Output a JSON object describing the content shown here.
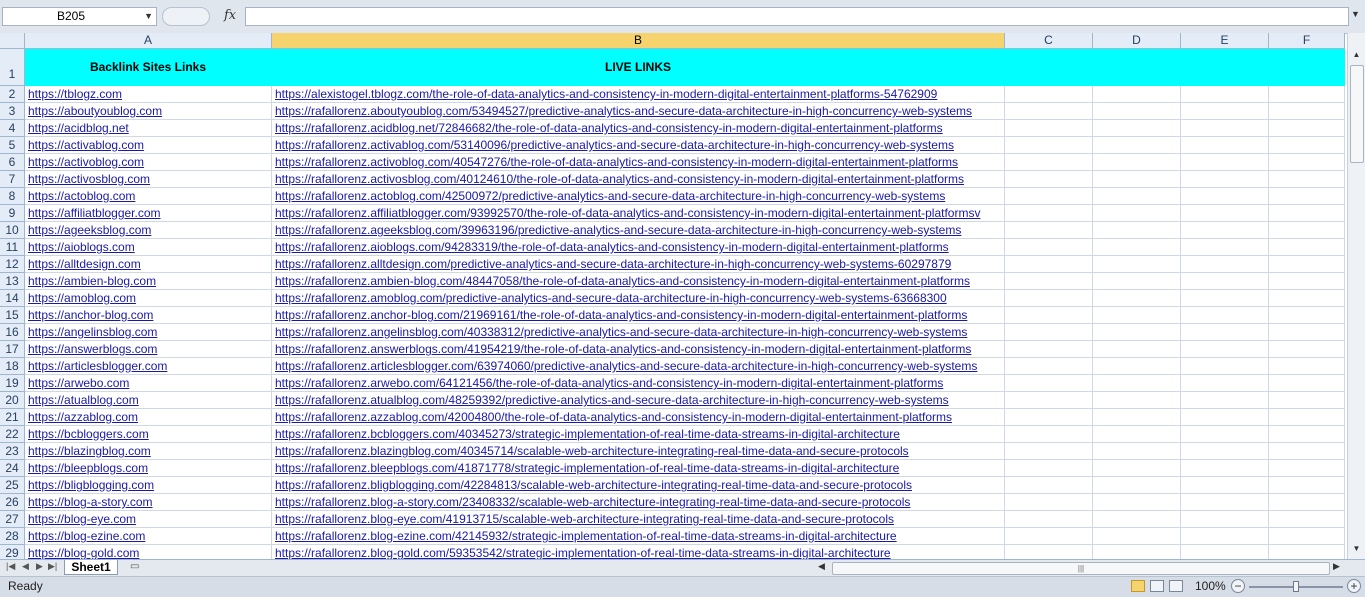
{
  "formula_bar": {
    "name_box": "B205",
    "fx_label": "fx",
    "formula": ""
  },
  "columns": [
    {
      "id": "A",
      "active": false
    },
    {
      "id": "B",
      "active": true
    },
    {
      "id": "C",
      "active": false
    },
    {
      "id": "D",
      "active": false
    },
    {
      "id": "E",
      "active": false
    },
    {
      "id": "F",
      "active": false
    }
  ],
  "header_row": {
    "row_number": "1",
    "col_a": "Backlink Sites Links",
    "col_b": "LIVE LINKS"
  },
  "rows": [
    {
      "n": "2",
      "a": "https://tblogz.com",
      "b": "https://alexistogel.tblogz.com/the-role-of-data-analytics-and-consistency-in-modern-digital-entertainment-platforms-54762909"
    },
    {
      "n": "3",
      "a": "https://aboutyoublog.com",
      "b": "https://rafallorenz.aboutyoublog.com/53494527/predictive-analytics-and-secure-data-architecture-in-high-concurrency-web-systems"
    },
    {
      "n": "4",
      "a": "https://acidblog.net",
      "b": "https://rafallorenz.acidblog.net/72846682/the-role-of-data-analytics-and-consistency-in-modern-digital-entertainment-platforms"
    },
    {
      "n": "5",
      "a": "https://activablog.com",
      "b": "https://rafallorenz.activablog.com/53140096/predictive-analytics-and-secure-data-architecture-in-high-concurrency-web-systems"
    },
    {
      "n": "6",
      "a": "https://activoblog.com",
      "b": "https://rafallorenz.activoblog.com/40547276/the-role-of-data-analytics-and-consistency-in-modern-digital-entertainment-platforms"
    },
    {
      "n": "7",
      "a": "https://activosblog.com",
      "b": "https://rafallorenz.activosblog.com/40124610/the-role-of-data-analytics-and-consistency-in-modern-digital-entertainment-platforms"
    },
    {
      "n": "8",
      "a": "https://actoblog.com",
      "b": "https://rafallorenz.actoblog.com/42500972/predictive-analytics-and-secure-data-architecture-in-high-concurrency-web-systems"
    },
    {
      "n": "9",
      "a": "https://affiliatblogger.com",
      "b": "https://rafallorenz.affiliatblogger.com/93992570/the-role-of-data-analytics-and-consistency-in-modern-digital-entertainment-platformsv"
    },
    {
      "n": "10",
      "a": "https://ageeksblog.com",
      "b": "https://rafallorenz.ageeksblog.com/39963196/predictive-analytics-and-secure-data-architecture-in-high-concurrency-web-systems"
    },
    {
      "n": "11",
      "a": "https://aioblogs.com",
      "b": "https://rafallorenz.aioblogs.com/94283319/the-role-of-data-analytics-and-consistency-in-modern-digital-entertainment-platforms"
    },
    {
      "n": "12",
      "a": "https://alltdesign.com",
      "b": "https://rafallorenz.alltdesign.com/predictive-analytics-and-secure-data-architecture-in-high-concurrency-web-systems-60297879"
    },
    {
      "n": "13",
      "a": "https://ambien-blog.com",
      "b": "https://rafallorenz.ambien-blog.com/48447058/the-role-of-data-analytics-and-consistency-in-modern-digital-entertainment-platforms"
    },
    {
      "n": "14",
      "a": "https://amoblog.com",
      "b": "https://rafallorenz.amoblog.com/predictive-analytics-and-secure-data-architecture-in-high-concurrency-web-systems-63668300"
    },
    {
      "n": "15",
      "a": "https://anchor-blog.com",
      "b": "https://rafallorenz.anchor-blog.com/21969161/the-role-of-data-analytics-and-consistency-in-modern-digital-entertainment-platforms"
    },
    {
      "n": "16",
      "a": "https://angelinsblog.com",
      "b": "https://rafallorenz.angelinsblog.com/40338312/predictive-analytics-and-secure-data-architecture-in-high-concurrency-web-systems"
    },
    {
      "n": "17",
      "a": "https://answerblogs.com",
      "b": "https://rafallorenz.answerblogs.com/41954219/the-role-of-data-analytics-and-consistency-in-modern-digital-entertainment-platforms"
    },
    {
      "n": "18",
      "a": "https://articlesblogger.com",
      "b": "https://rafallorenz.articlesblogger.com/63974060/predictive-analytics-and-secure-data-architecture-in-high-concurrency-web-systems"
    },
    {
      "n": "19",
      "a": "https://arwebo.com",
      "b": "https://rafallorenz.arwebo.com/64121456/the-role-of-data-analytics-and-consistency-in-modern-digital-entertainment-platforms"
    },
    {
      "n": "20",
      "a": "https://atualblog.com",
      "b": "https://rafallorenz.atualblog.com/48259392/predictive-analytics-and-secure-data-architecture-in-high-concurrency-web-systems"
    },
    {
      "n": "21",
      "a": "https://azzablog.com",
      "b": "https://rafallorenz.azzablog.com/42004800/the-role-of-data-analytics-and-consistency-in-modern-digital-entertainment-platforms"
    },
    {
      "n": "22",
      "a": "https://bcbloggers.com",
      "b": "https://rafallorenz.bcbloggers.com/40345273/strategic-implementation-of-real-time-data-streams-in-digital-architecture"
    },
    {
      "n": "23",
      "a": "https://blazingblog.com",
      "b": "https://rafallorenz.blazingblog.com/40345714/scalable-web-architecture-integrating-real-time-data-and-secure-protocols"
    },
    {
      "n": "24",
      "a": "https://bleepblogs.com",
      "b": "https://rafallorenz.bleepblogs.com/41871778/strategic-implementation-of-real-time-data-streams-in-digital-architecture"
    },
    {
      "n": "25",
      "a": "https://bligblogging.com",
      "b": "https://rafallorenz.bligblogging.com/42284813/scalable-web-architecture-integrating-real-time-data-and-secure-protocols"
    },
    {
      "n": "26",
      "a": "https://blog-a-story.com",
      "b": "https://rafallorenz.blog-a-story.com/23408332/scalable-web-architecture-integrating-real-time-data-and-secure-protocols"
    },
    {
      "n": "27",
      "a": "https://blog-eye.com",
      "b": "https://rafallorenz.blog-eye.com/41913715/scalable-web-architecture-integrating-real-time-data-and-secure-protocols"
    },
    {
      "n": "28",
      "a": "https://blog-ezine.com",
      "b": "https://rafallorenz.blog-ezine.com/42145932/strategic-implementation-of-real-time-data-streams-in-digital-architecture"
    },
    {
      "n": "29",
      "a": "https://blog-gold.com",
      "b": "https://rafallorenz.blog-gold.com/59353542/strategic-implementation-of-real-time-data-streams-in-digital-architecture"
    }
  ],
  "sheet_tabs": {
    "active": "Sheet1",
    "new_sheet_icon": "insert-sheet-icon"
  },
  "status_bar": {
    "status": "Ready",
    "zoom": "100%",
    "zoom_fraction": 0.5,
    "view": "normal"
  },
  "colors": {
    "header_fill": "#00ffff",
    "link": "#1a1aa6",
    "active_column": "#f7d36e"
  }
}
